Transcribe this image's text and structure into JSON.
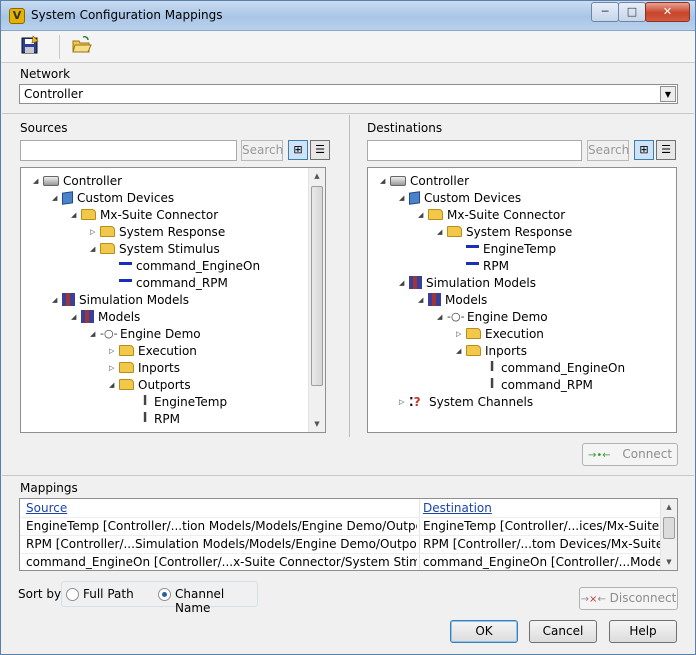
{
  "window": {
    "title": "System Configuration Mappings",
    "minimize": "─",
    "maximize": "□",
    "close": "✕"
  },
  "toolbar": {
    "save_icon": "save-icon",
    "open_icon": "open-folder-icon"
  },
  "network": {
    "label": "Network",
    "value": "Controller"
  },
  "sources": {
    "label": "Sources",
    "search_placeholder": "",
    "search_button": "Search",
    "tree": [
      {
        "label": "Controller",
        "icon": "controller-icon",
        "depth": 0,
        "expander": "open"
      },
      {
        "label": "Custom Devices",
        "icon": "cube-icon",
        "depth": 1,
        "expander": "open"
      },
      {
        "label": "Mx-Suite Connector",
        "icon": "folder-icon",
        "depth": 2,
        "expander": "open"
      },
      {
        "label": "System Response",
        "icon": "folder-icon",
        "depth": 3,
        "expander": "closed"
      },
      {
        "label": "System Stimulus",
        "icon": "folder-icon",
        "depth": 3,
        "expander": "open"
      },
      {
        "label": "command_EngineOn",
        "icon": "channel-icon",
        "depth": 4,
        "expander": "none"
      },
      {
        "label": "command_RPM",
        "icon": "channel-icon",
        "depth": 4,
        "expander": "none"
      },
      {
        "label": "Simulation Models",
        "icon": "books-icon",
        "depth": 1,
        "expander": "open"
      },
      {
        "label": "Models",
        "icon": "books-icon",
        "depth": 2,
        "expander": "open"
      },
      {
        "label": "Engine Demo",
        "icon": "model-icon",
        "depth": 3,
        "expander": "open"
      },
      {
        "label": "Execution",
        "icon": "folder-icon",
        "depth": 4,
        "expander": "closed"
      },
      {
        "label": "Inports",
        "icon": "folder-icon",
        "depth": 4,
        "expander": "closed"
      },
      {
        "label": "Outports",
        "icon": "folder-icon",
        "depth": 4,
        "expander": "open"
      },
      {
        "label": "EngineTemp",
        "icon": "ibeam-icon",
        "depth": 5,
        "expander": "none"
      },
      {
        "label": "RPM",
        "icon": "ibeam-icon",
        "depth": 5,
        "expander": "none"
      }
    ]
  },
  "destinations": {
    "label": "Destinations",
    "search_placeholder": "",
    "search_button": "Search",
    "tree": [
      {
        "label": "Controller",
        "icon": "controller-icon",
        "depth": 0,
        "expander": "open"
      },
      {
        "label": "Custom Devices",
        "icon": "cube-icon",
        "depth": 1,
        "expander": "open"
      },
      {
        "label": "Mx-Suite Connector",
        "icon": "folder-icon",
        "depth": 2,
        "expander": "open"
      },
      {
        "label": "System Response",
        "icon": "folder-icon",
        "depth": 3,
        "expander": "open"
      },
      {
        "label": "EngineTemp",
        "icon": "channel-icon",
        "depth": 4,
        "expander": "none"
      },
      {
        "label": "RPM",
        "icon": "channel-icon",
        "depth": 4,
        "expander": "none"
      },
      {
        "label": "Simulation Models",
        "icon": "books-icon",
        "depth": 1,
        "expander": "open"
      },
      {
        "label": "Models",
        "icon": "books-icon",
        "depth": 2,
        "expander": "open"
      },
      {
        "label": "Engine Demo",
        "icon": "model-icon",
        "depth": 3,
        "expander": "open"
      },
      {
        "label": "Execution",
        "icon": "folder-icon",
        "depth": 4,
        "expander": "closed"
      },
      {
        "label": "Inports",
        "icon": "folder-icon",
        "depth": 4,
        "expander": "open"
      },
      {
        "label": "command_EngineOn",
        "icon": "ibeam-icon",
        "depth": 5,
        "expander": "none"
      },
      {
        "label": "command_RPM",
        "icon": "ibeam-icon",
        "depth": 5,
        "expander": "none"
      },
      {
        "label": "System Channels",
        "icon": "system-channels-icon",
        "depth": 1,
        "expander": "closed"
      }
    ]
  },
  "connect_button": "Connect",
  "mappings": {
    "label": "Mappings",
    "columns": [
      "Source",
      "Destination"
    ],
    "rows": [
      [
        "EngineTemp [Controller/...tion Models/Models/Engine Demo/Outports/]",
        "EngineTemp [Controller/...ices/Mx-Suite Connector/System Response/]"
      ],
      [
        "RPM [Controller/...Simulation Models/Models/Engine Demo/Outports/]",
        "RPM [Controller/...tom Devices/Mx-Suite Connector/System Response/]"
      ],
      [
        "command_EngineOn [Controller/...x-Suite Connector/System Stimulus/]",
        "command_EngineOn [Controller/...Models/Models/Engine Demo/Inports/]"
      ]
    ]
  },
  "sort": {
    "label": "Sort by:",
    "options": [
      "Full Path",
      "Channel Name"
    ],
    "selected": "Channel Name"
  },
  "disconnect_button": "Disconnect",
  "footer": {
    "ok": "OK",
    "cancel": "Cancel",
    "help": "Help"
  }
}
